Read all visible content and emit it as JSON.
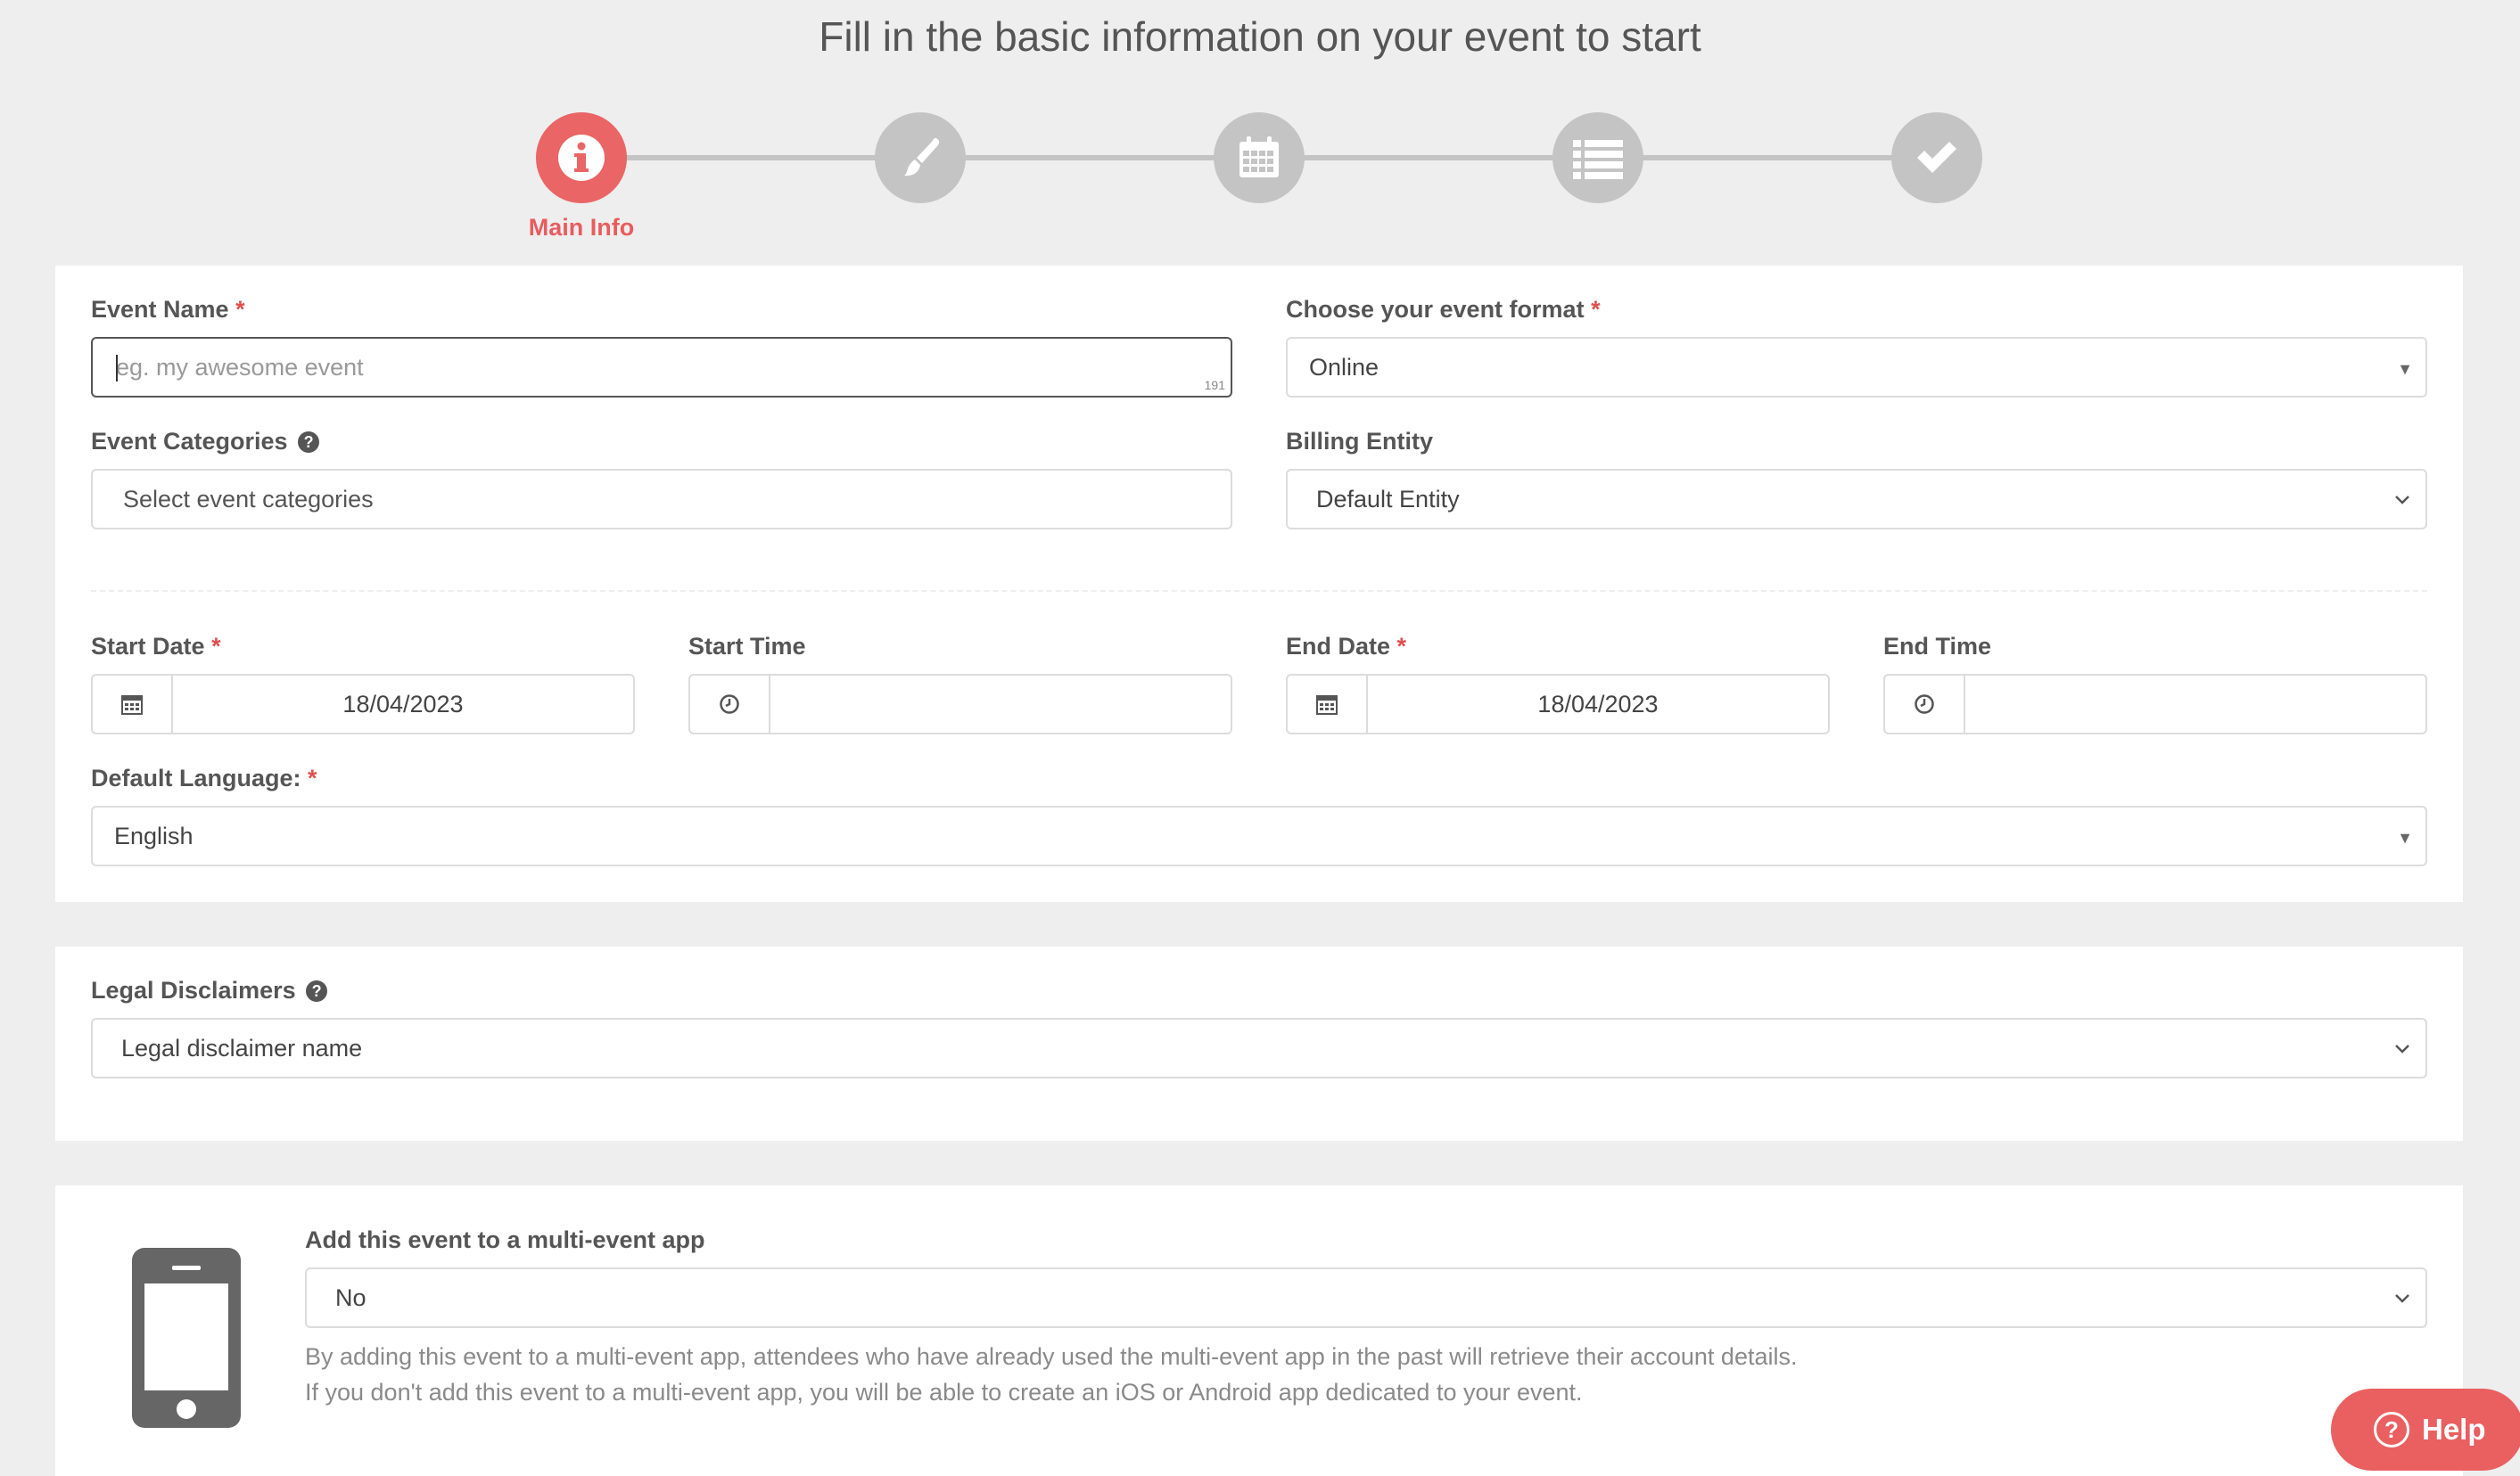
{
  "page_title": "Fill in the basic information on your event to start",
  "stepper": {
    "active_label": "Main Info",
    "steps": [
      {
        "icon": "info-icon"
      },
      {
        "icon": "brush-icon"
      },
      {
        "icon": "calendar-icon"
      },
      {
        "icon": "list-icon"
      },
      {
        "icon": "check-icon"
      }
    ]
  },
  "main_card": {
    "event_name": {
      "label": "Event Name",
      "placeholder": "eg. my awesome event",
      "counter": "191"
    },
    "event_format": {
      "label": "Choose your event format",
      "value": "Online"
    },
    "event_categories": {
      "label": "Event Categories",
      "placeholder": "Select event categories"
    },
    "billing_entity": {
      "label": "Billing Entity",
      "value": "Default Entity"
    },
    "start_date": {
      "label": "Start Date",
      "value": "18/04/2023"
    },
    "start_time": {
      "label": "Start Time",
      "value": ""
    },
    "end_date": {
      "label": "End Date",
      "value": "18/04/2023"
    },
    "end_time": {
      "label": "End Time",
      "value": ""
    },
    "default_language": {
      "label": "Default Language:",
      "value": "English"
    },
    "required_mark": "*",
    "help_mark": "?"
  },
  "legal_card": {
    "label": "Legal Disclaimers",
    "value": "Legal disclaimer name"
  },
  "app_card": {
    "label": "Add this event to a multi-event app",
    "value": "No",
    "note_line1": "By adding this event to a multi-event app, attendees who have already used the multi-event app in the past will retrieve their account details.",
    "note_line2": "If you don't add this event to a multi-event app, you will be able to create an iOS or Android app dedicated to your event."
  },
  "help_button": {
    "label": "Help",
    "icon_text": "?"
  },
  "colors": {
    "accent": "#ea6566",
    "step_inactive": "#c4c4c4",
    "required": "#e04f4f"
  }
}
